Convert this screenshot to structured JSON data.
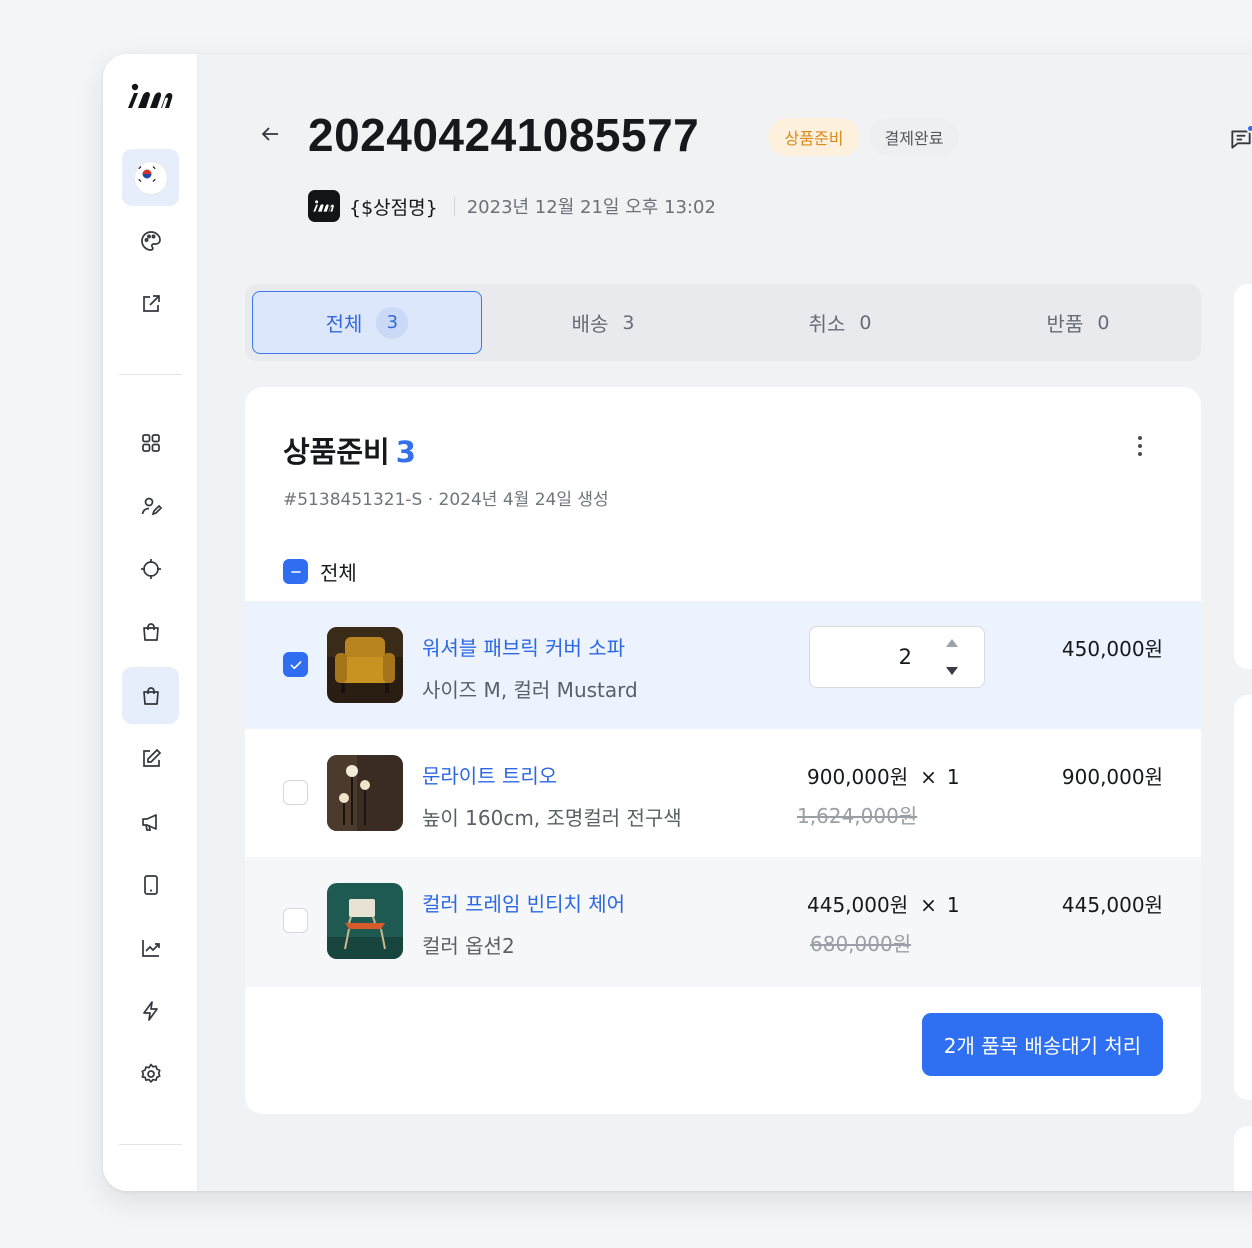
{
  "colors": {
    "accent": "#2f6ff2",
    "badge_prep_bg": "#fdf0dc",
    "badge_prep_text": "#d98a1c",
    "selected_row": "#ecf3fe"
  },
  "sidebar": {
    "logo": "im",
    "icons": [
      "flag-kr-icon",
      "palette-icon",
      "external-link-icon",
      "grid-icon",
      "user-edit-icon",
      "crosshair-icon",
      "bag-icon",
      "bag-icon-active",
      "edit-icon",
      "megaphone-icon",
      "tablet-icon",
      "chart-icon",
      "lightning-icon",
      "gear-icon"
    ],
    "active_item": "bag-icon-active"
  },
  "header": {
    "order_number": "202404241085577",
    "badges": [
      "상품준비",
      "결제완료"
    ],
    "shop_name": "{$상점명}",
    "order_date": "2023년 12월 21일 오후 13:02"
  },
  "tabs": [
    {
      "label": "전체",
      "count": "3",
      "active": true
    },
    {
      "label": "배송",
      "count": "3",
      "active": false
    },
    {
      "label": "취소",
      "count": "0",
      "active": false
    },
    {
      "label": "반품",
      "count": "0",
      "active": false
    }
  ],
  "card": {
    "title": "상품준비",
    "count": "3",
    "subtitle": "#5138451321-S · 2024년 4월 24일 생성",
    "select_all_label": "전체",
    "items": [
      {
        "name": "워셔블 패브릭 커버 소파",
        "option": "사이즈 M, 컬러 Mustard",
        "quantity": "2",
        "total": "450,000원",
        "checked": true
      },
      {
        "name": "문라이트 트리오",
        "option": "높이 160cm, 조명컬러 전구색",
        "unit_price": "900,000원",
        "times": "×",
        "qty": "1",
        "original_price": "1,624,000원",
        "total": "900,000원",
        "checked": false
      },
      {
        "name": "컬러 프레임 빈티치 체어",
        "option": "컬러 옵션2",
        "unit_price": "445,000원",
        "times": "×",
        "qty": "1",
        "original_price": "680,000원",
        "total": "445,000원",
        "checked": false
      }
    ],
    "action_button": "2개 품목 배송대기 처리"
  }
}
